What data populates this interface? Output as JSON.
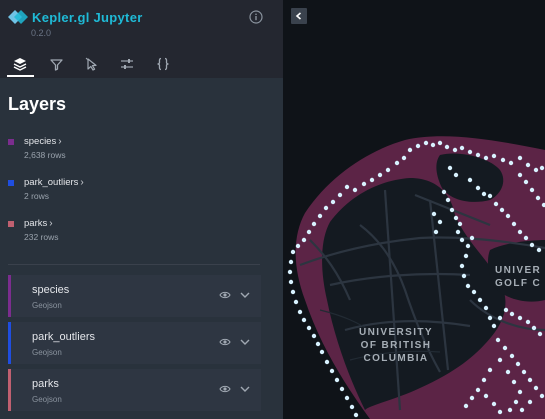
{
  "app": {
    "title": "Kepler.gl Jupyter",
    "version": "0.2.0",
    "brand_color": "#1fbad6"
  },
  "tabs": [
    {
      "name": "layers",
      "icon": "layers-icon",
      "active": true
    },
    {
      "name": "filters",
      "icon": "filter-icon",
      "active": false
    },
    {
      "name": "interactions",
      "icon": "cursor-icon",
      "active": false
    },
    {
      "name": "base-map",
      "icon": "sliders-icon",
      "active": false
    },
    {
      "name": "config",
      "icon": "braces-icon",
      "active": false
    }
  ],
  "layers_panel": {
    "title": "Layers",
    "legend": [
      {
        "name": "species",
        "rows": "2,638 rows",
        "color": "#7b2d8e"
      },
      {
        "name": "park_outliers",
        "rows": "2 rows",
        "color": "#1f4ee0"
      },
      {
        "name": "parks",
        "rows": "232 rows",
        "color": "#c06070"
      }
    ],
    "layers": [
      {
        "name": "species",
        "type": "Geojson",
        "color": "#7b2d8e"
      },
      {
        "name": "park_outliers",
        "type": "Geojson",
        "color": "#1f4ee0"
      },
      {
        "name": "parks",
        "type": "Geojson",
        "color": "#c06070"
      }
    ]
  },
  "map": {
    "labels": {
      "ubc_line1": "UNIVERSITY",
      "ubc_line2": "OF BRITISH",
      "ubc_line3": "COLUMBIA",
      "golf_line1": "UNIVER",
      "golf_line2": "GOLF C"
    },
    "land_color": "#5c2446",
    "point_color": "#d8f2ff"
  }
}
